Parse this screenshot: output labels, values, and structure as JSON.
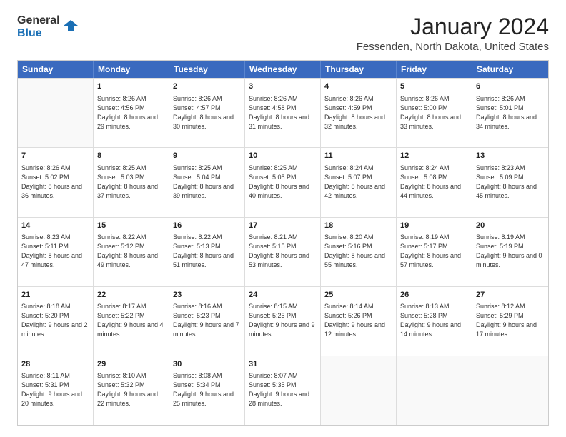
{
  "logo": {
    "line1": "General",
    "line2": "Blue"
  },
  "title": "January 2024",
  "subtitle": "Fessenden, North Dakota, United States",
  "days_of_week": [
    "Sunday",
    "Monday",
    "Tuesday",
    "Wednesday",
    "Thursday",
    "Friday",
    "Saturday"
  ],
  "weeks": [
    [
      {
        "day": "",
        "sunrise": "",
        "sunset": "",
        "daylight": "",
        "empty": true
      },
      {
        "day": "1",
        "sunrise": "Sunrise: 8:26 AM",
        "sunset": "Sunset: 4:56 PM",
        "daylight": "Daylight: 8 hours and 29 minutes."
      },
      {
        "day": "2",
        "sunrise": "Sunrise: 8:26 AM",
        "sunset": "Sunset: 4:57 PM",
        "daylight": "Daylight: 8 hours and 30 minutes."
      },
      {
        "day": "3",
        "sunrise": "Sunrise: 8:26 AM",
        "sunset": "Sunset: 4:58 PM",
        "daylight": "Daylight: 8 hours and 31 minutes."
      },
      {
        "day": "4",
        "sunrise": "Sunrise: 8:26 AM",
        "sunset": "Sunset: 4:59 PM",
        "daylight": "Daylight: 8 hours and 32 minutes."
      },
      {
        "day": "5",
        "sunrise": "Sunrise: 8:26 AM",
        "sunset": "Sunset: 5:00 PM",
        "daylight": "Daylight: 8 hours and 33 minutes."
      },
      {
        "day": "6",
        "sunrise": "Sunrise: 8:26 AM",
        "sunset": "Sunset: 5:01 PM",
        "daylight": "Daylight: 8 hours and 34 minutes."
      }
    ],
    [
      {
        "day": "7",
        "sunrise": "Sunrise: 8:26 AM",
        "sunset": "Sunset: 5:02 PM",
        "daylight": "Daylight: 8 hours and 36 minutes."
      },
      {
        "day": "8",
        "sunrise": "Sunrise: 8:25 AM",
        "sunset": "Sunset: 5:03 PM",
        "daylight": "Daylight: 8 hours and 37 minutes."
      },
      {
        "day": "9",
        "sunrise": "Sunrise: 8:25 AM",
        "sunset": "Sunset: 5:04 PM",
        "daylight": "Daylight: 8 hours and 39 minutes."
      },
      {
        "day": "10",
        "sunrise": "Sunrise: 8:25 AM",
        "sunset": "Sunset: 5:05 PM",
        "daylight": "Daylight: 8 hours and 40 minutes."
      },
      {
        "day": "11",
        "sunrise": "Sunrise: 8:24 AM",
        "sunset": "Sunset: 5:07 PM",
        "daylight": "Daylight: 8 hours and 42 minutes."
      },
      {
        "day": "12",
        "sunrise": "Sunrise: 8:24 AM",
        "sunset": "Sunset: 5:08 PM",
        "daylight": "Daylight: 8 hours and 44 minutes."
      },
      {
        "day": "13",
        "sunrise": "Sunrise: 8:23 AM",
        "sunset": "Sunset: 5:09 PM",
        "daylight": "Daylight: 8 hours and 45 minutes."
      }
    ],
    [
      {
        "day": "14",
        "sunrise": "Sunrise: 8:23 AM",
        "sunset": "Sunset: 5:11 PM",
        "daylight": "Daylight: 8 hours and 47 minutes."
      },
      {
        "day": "15",
        "sunrise": "Sunrise: 8:22 AM",
        "sunset": "Sunset: 5:12 PM",
        "daylight": "Daylight: 8 hours and 49 minutes."
      },
      {
        "day": "16",
        "sunrise": "Sunrise: 8:22 AM",
        "sunset": "Sunset: 5:13 PM",
        "daylight": "Daylight: 8 hours and 51 minutes."
      },
      {
        "day": "17",
        "sunrise": "Sunrise: 8:21 AM",
        "sunset": "Sunset: 5:15 PM",
        "daylight": "Daylight: 8 hours and 53 minutes."
      },
      {
        "day": "18",
        "sunrise": "Sunrise: 8:20 AM",
        "sunset": "Sunset: 5:16 PM",
        "daylight": "Daylight: 8 hours and 55 minutes."
      },
      {
        "day": "19",
        "sunrise": "Sunrise: 8:19 AM",
        "sunset": "Sunset: 5:17 PM",
        "daylight": "Daylight: 8 hours and 57 minutes."
      },
      {
        "day": "20",
        "sunrise": "Sunrise: 8:19 AM",
        "sunset": "Sunset: 5:19 PM",
        "daylight": "Daylight: 9 hours and 0 minutes."
      }
    ],
    [
      {
        "day": "21",
        "sunrise": "Sunrise: 8:18 AM",
        "sunset": "Sunset: 5:20 PM",
        "daylight": "Daylight: 9 hours and 2 minutes."
      },
      {
        "day": "22",
        "sunrise": "Sunrise: 8:17 AM",
        "sunset": "Sunset: 5:22 PM",
        "daylight": "Daylight: 9 hours and 4 minutes."
      },
      {
        "day": "23",
        "sunrise": "Sunrise: 8:16 AM",
        "sunset": "Sunset: 5:23 PM",
        "daylight": "Daylight: 9 hours and 7 minutes."
      },
      {
        "day": "24",
        "sunrise": "Sunrise: 8:15 AM",
        "sunset": "Sunset: 5:25 PM",
        "daylight": "Daylight: 9 hours and 9 minutes."
      },
      {
        "day": "25",
        "sunrise": "Sunrise: 8:14 AM",
        "sunset": "Sunset: 5:26 PM",
        "daylight": "Daylight: 9 hours and 12 minutes."
      },
      {
        "day": "26",
        "sunrise": "Sunrise: 8:13 AM",
        "sunset": "Sunset: 5:28 PM",
        "daylight": "Daylight: 9 hours and 14 minutes."
      },
      {
        "day": "27",
        "sunrise": "Sunrise: 8:12 AM",
        "sunset": "Sunset: 5:29 PM",
        "daylight": "Daylight: 9 hours and 17 minutes."
      }
    ],
    [
      {
        "day": "28",
        "sunrise": "Sunrise: 8:11 AM",
        "sunset": "Sunset: 5:31 PM",
        "daylight": "Daylight: 9 hours and 20 minutes."
      },
      {
        "day": "29",
        "sunrise": "Sunrise: 8:10 AM",
        "sunset": "Sunset: 5:32 PM",
        "daylight": "Daylight: 9 hours and 22 minutes."
      },
      {
        "day": "30",
        "sunrise": "Sunrise: 8:08 AM",
        "sunset": "Sunset: 5:34 PM",
        "daylight": "Daylight: 9 hours and 25 minutes."
      },
      {
        "day": "31",
        "sunrise": "Sunrise: 8:07 AM",
        "sunset": "Sunset: 5:35 PM",
        "daylight": "Daylight: 9 hours and 28 minutes."
      },
      {
        "day": "",
        "sunrise": "",
        "sunset": "",
        "daylight": "",
        "empty": true
      },
      {
        "day": "",
        "sunrise": "",
        "sunset": "",
        "daylight": "",
        "empty": true
      },
      {
        "day": "",
        "sunrise": "",
        "sunset": "",
        "daylight": "",
        "empty": true
      }
    ]
  ]
}
